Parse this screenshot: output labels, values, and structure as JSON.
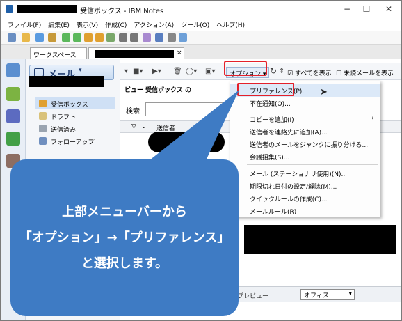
{
  "window": {
    "title": "受信ボックス - IBM Notes",
    "controls": {
      "minimize": "−",
      "maximize": "☐",
      "close": "✕"
    }
  },
  "menubar": {
    "items": [
      "ファイル(F)",
      "編集(E)",
      "表示(V)",
      "作成(C)",
      "アクション(A)",
      "ツール(O)",
      "ヘルプ(H)"
    ]
  },
  "tabs": {
    "workspace": "ワークスペース",
    "close_glyph": "×"
  },
  "navigator": {
    "title": "メール",
    "items": [
      {
        "label": "受信ボックス",
        "icon": "inbox-icon",
        "selected": true
      },
      {
        "label": "ドラフト",
        "icon": "draft-icon",
        "selected": false
      },
      {
        "label": "送信済み",
        "icon": "sent-icon",
        "selected": false
      },
      {
        "label": "フォローアップ",
        "icon": "flag-icon",
        "selected": false
      }
    ]
  },
  "content_toolbar": {
    "options_label": "オプション",
    "show_all_label": "すべてを表示",
    "unread_label": "未読メールを表示"
  },
  "view": {
    "title": "ビュー 受信ボックス の",
    "search_label": "検索",
    "sender_column": "送信者"
  },
  "options_menu": {
    "items": [
      {
        "label": "プリファレンス(P)...",
        "has_submenu": false
      },
      {
        "label": "不在通知(O)...",
        "has_submenu": false
      },
      {
        "label": "コピーを追加(I)",
        "has_submenu": true
      },
      {
        "label": "送信者を連絡先に追加(A)...",
        "has_submenu": false
      },
      {
        "label": "送信者のメールをジャンクに振り分ける...",
        "has_submenu": false
      },
      {
        "label": "会議招集(S)...",
        "has_submenu": false
      },
      {
        "label": "メール (ステーショナリ使用)(N)...",
        "has_submenu": false
      },
      {
        "label": "期限切れ日付の設定/解除(M)...",
        "has_submenu": false
      },
      {
        "label": "クイックルールの作成(C)...",
        "has_submenu": false
      },
      {
        "label": "メールルール(R)",
        "has_submenu": false
      }
    ]
  },
  "status": {
    "preview_label": "プレビュー",
    "location": "オフィス"
  },
  "callout": {
    "line1": "上部メニューバーから",
    "line2": "「オプション」→「プリファレンス」",
    "line3": "と選択します。"
  },
  "colors": {
    "accent": "#3e7bc4",
    "highlight": "#e4202a"
  }
}
